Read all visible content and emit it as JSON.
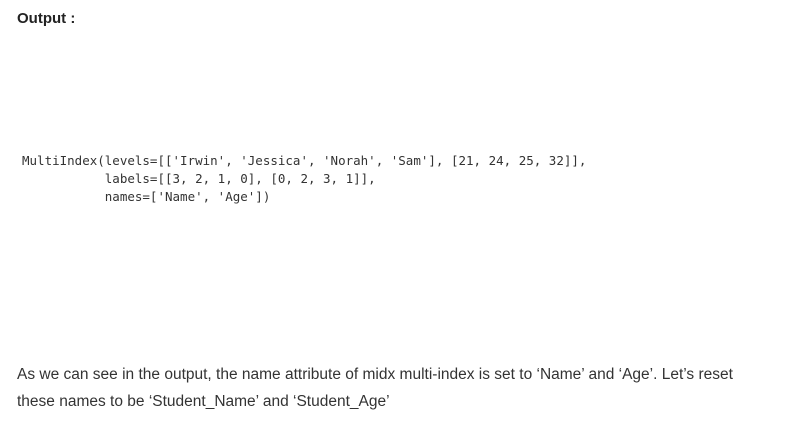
{
  "heading": "Output :",
  "code": {
    "lines": [
      "MultiIndex(levels=[['Irwin', 'Jessica', 'Norah', 'Sam'], [21, 24, 25, 32]],",
      "           labels=[[3, 2, 1, 0], [0, 2, 3, 1]],",
      "           names=['Name', 'Age'])"
    ]
  },
  "paragraph": "As we can see in the output, the name attribute of midx multi-index is set to ‘Name’ and ‘Age’. Let’s reset these names to be ‘Student_Name’ and ‘Student_Age’"
}
